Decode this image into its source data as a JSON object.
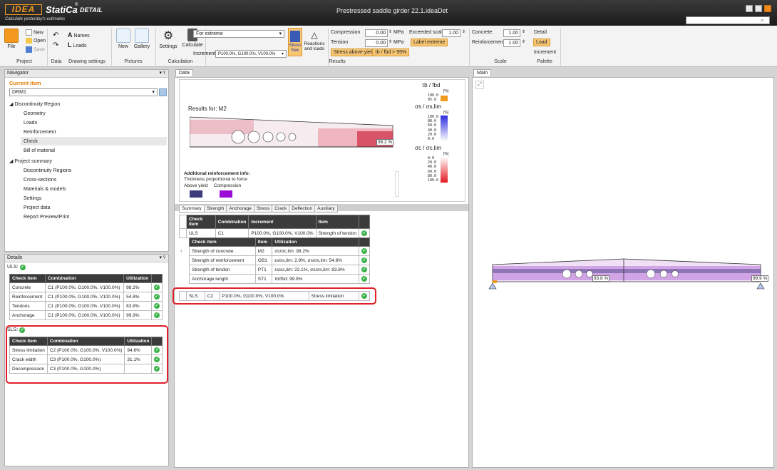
{
  "app": {
    "logo": "IDEA",
    "name": "StatiCa",
    "module": "DETAIL",
    "tagline": "Calculate yesterday's estimates",
    "document_title": "Prestressed saddle girder 22.1.ideaDet"
  },
  "ribbon": {
    "file": "File",
    "new": "New",
    "open": "Open",
    "save": "Save",
    "names": "Names",
    "loads": "Loads",
    "new_picture": "New",
    "gallery": "Gallery",
    "settings": "Settings",
    "calculate": "Calculate",
    "extreme_select": "For extreme",
    "increment_label": "Increment",
    "increment_select": "P100.0%, G100.0%, V100.0%",
    "stress_flow": "Stress flow",
    "reactions": "Reactions and loads",
    "compression_label": "Compression",
    "compression_value": "0.00",
    "tension_label": "Tension",
    "tension_value": "0.00",
    "unit": "MPa",
    "exceeded_scale_label": "Exceeded scale",
    "exceeded_scale_value": "1.00",
    "label_extreme": "Label extreme",
    "stress_above_yield": "Stress above yield",
    "tb_fbd": "τb / fbd > 95%",
    "concrete_label": "Concrete",
    "concrete_value": "1.00",
    "reinforcement_label": "Reinforcement",
    "reinforcement_value": "1.00",
    "detail": "Detail",
    "load_btn": "Load",
    "increment_btn": "Increment",
    "groups": [
      "Project",
      "Data",
      "Drawing settings",
      "Pictures",
      "Calculation",
      "Results",
      "Scale",
      "Palette"
    ]
  },
  "navigator": {
    "title": "Navigator",
    "current_item": "Current item",
    "current_value": "DRM1",
    "section1": "Discontinuity Region",
    "items1": [
      "Geometry",
      "Loads",
      "Reinforcement",
      "Check",
      "Bill of material"
    ],
    "section2": "Project summary",
    "items2": [
      "Discontinuity Regions",
      "Cross-sections",
      "Materials & models",
      "Settings",
      "Project data",
      "Report Preview/Print"
    ]
  },
  "details": {
    "title": "Details",
    "uls_label": "ULS:",
    "sls_label": "SLS:",
    "headers": [
      "Check item",
      "Combination",
      "Utilization"
    ],
    "uls_rows": [
      [
        "Concrete",
        "C1 (P100.0%, G100.0%, V100.0%)",
        "98.2%"
      ],
      [
        "Reinforcement",
        "C1 (P100.0%, G100.0%, V100.0%)",
        "54.8%"
      ],
      [
        "Tendons",
        "C1 (P100.0%, G100.0%, V100.0%)",
        "83.8%"
      ],
      [
        "Anchorage",
        "C1 (P100.0%, G100.0%, V100.0%)",
        "99.9%"
      ]
    ],
    "sls_rows": [
      [
        "Stress limitation",
        "C2 (P100.0%, G100.0%, V100.0%)",
        "94.6%"
      ],
      [
        "Crack width",
        "C3 (P100.0%, G100.0%)",
        "31.1%"
      ],
      [
        "Decompression",
        "C3 (P100.0%, G100.0%)",
        ""
      ]
    ]
  },
  "data_panel": {
    "tab": "Data",
    "results_for": "Results for: M2",
    "extreme_label": "98.2 %",
    "legend1_title": "τb / fbd",
    "legend1_unit": "[%]",
    "legend1_ticks": [
      "100.0",
      "95.0"
    ],
    "legend2_title": "σs / σs,lim",
    "legend2_unit": "[%]",
    "legend2_ticks": [
      "100.0",
      "80.0",
      "60.0",
      "40.0",
      "20.0",
      "0.0"
    ],
    "legend3_title": "σc / σc,lim",
    "legend3_unit": "[%]",
    "legend3_ticks": [
      "0.0",
      "20.0",
      "40.0",
      "60.0",
      "80.0",
      "100.0"
    ],
    "add_info_title": "Additional reinforcement info:",
    "add_info_sub": "Thickness proportional to force",
    "above_yield": "Above yield",
    "compression": "Compression",
    "sub_tabs": [
      "Summary",
      "Strength",
      "Anchorage",
      "Stress",
      "Crack",
      "Deflection",
      "Auxiliary"
    ],
    "summary_headers": [
      "Check item",
      "Combination",
      "Increment",
      "Item"
    ],
    "uls_row": [
      "ULS",
      "C1",
      "P100.0%, G100.0%, V100.0%",
      "Strength of tendon"
    ],
    "inner_headers": [
      "Check item",
      "Item",
      "Utilization"
    ],
    "inner_rows": [
      [
        "Strength of concrete",
        "M2",
        "σc/σc,lim: 98.2%"
      ],
      [
        "Strength of reinforcement",
        "GB1",
        "εs/εs,lim: 2.9%, σs/σs,lim: 54.8%"
      ],
      [
        "Strength of tendon",
        "PT1",
        "εs/εs,lim: 22.1%, σs/σs,lim: 83.8%"
      ],
      [
        "Anchorage length",
        "ST1",
        "τb/fbd: 99.9%"
      ]
    ],
    "sls_row": [
      "SLS",
      "C2",
      "P100.0%, G100.0%, V100.0%",
      "Stress limitation"
    ]
  },
  "main_panel": {
    "tab": "Main",
    "label_mid": "83.8 %",
    "label_right": "99.9 %"
  }
}
